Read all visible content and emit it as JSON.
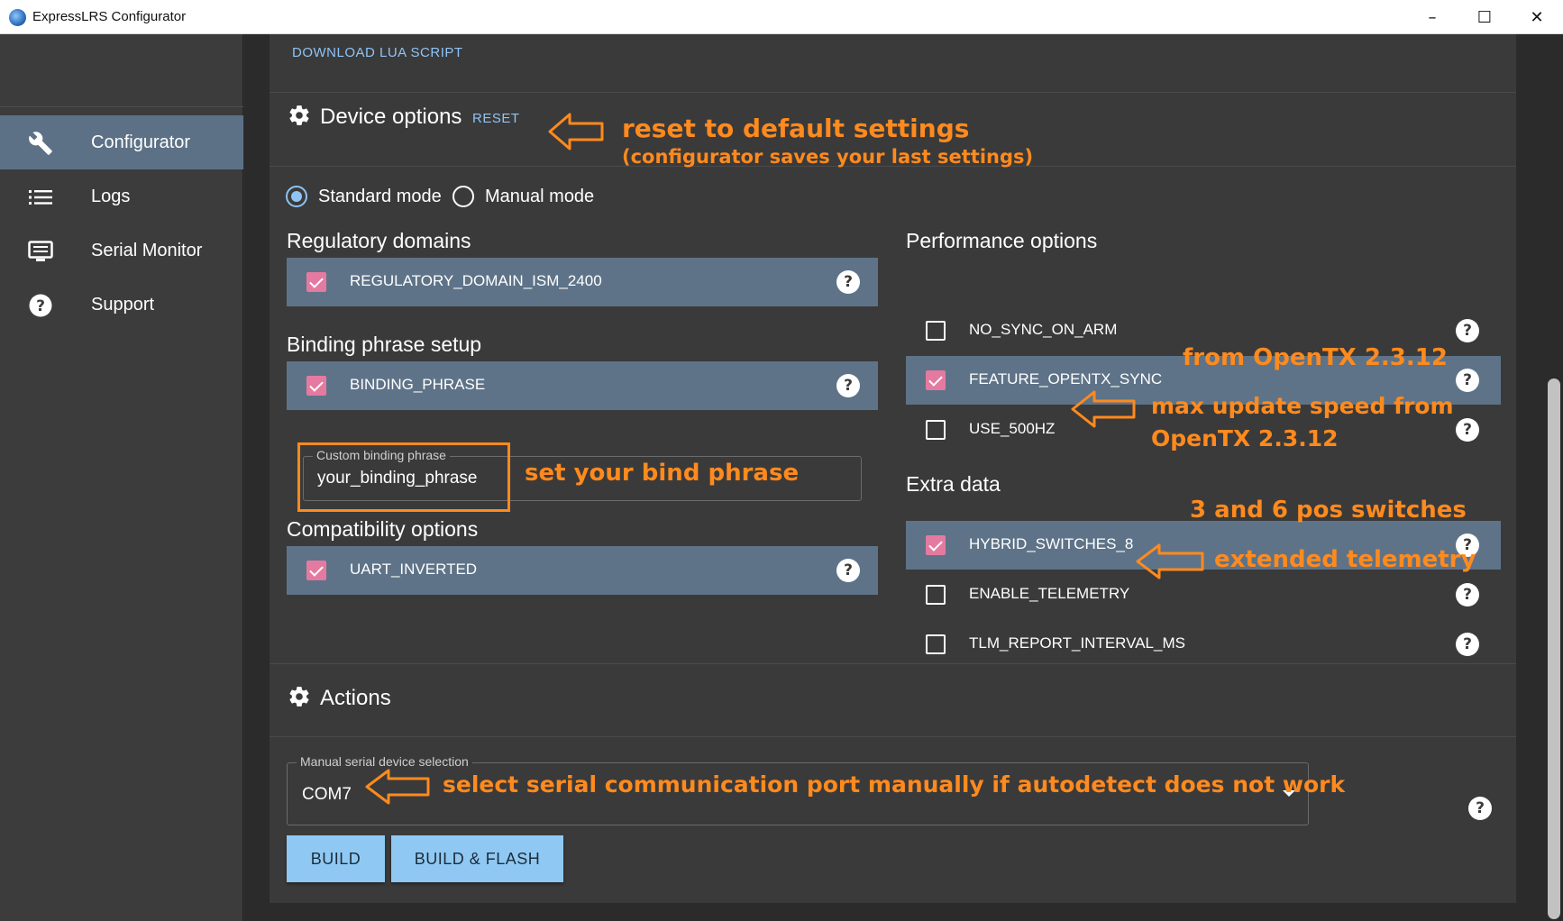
{
  "window": {
    "title": "ExpressLRS Configurator",
    "minimize": "–",
    "maximize": "☐",
    "close": "✕"
  },
  "sidebar": {
    "items": [
      {
        "label": "Configurator",
        "icon": "wrench-icon",
        "active": true
      },
      {
        "label": "Logs",
        "icon": "list-icon",
        "active": false
      },
      {
        "label": "Serial Monitor",
        "icon": "serial-monitor-icon",
        "active": false
      },
      {
        "label": "Support",
        "icon": "help-circle-icon",
        "active": false
      }
    ]
  },
  "main": {
    "download_lua": "DOWNLOAD LUA SCRIPT",
    "device_options": {
      "title": "Device options",
      "reset_label": "RESET",
      "modes": [
        {
          "label": "Standard mode",
          "checked": true
        },
        {
          "label": "Manual mode",
          "checked": false
        }
      ],
      "regulatory": {
        "title": "Regulatory domains",
        "options": [
          {
            "label": "REGULATORY_DOMAIN_ISM_2400",
            "checked": true
          }
        ]
      },
      "binding": {
        "title": "Binding phrase setup",
        "options": [
          {
            "label": "BINDING_PHRASE",
            "checked": true
          }
        ],
        "field_label": "Custom binding phrase",
        "field_value": "your_binding_phrase"
      },
      "compatibility": {
        "title": "Compatibility options",
        "options": [
          {
            "label": "UART_INVERTED",
            "checked": true
          }
        ]
      },
      "performance": {
        "title": "Performance options",
        "options": [
          {
            "label": "NO_SYNC_ON_ARM",
            "checked": false
          },
          {
            "label": "FEATURE_OPENTX_SYNC",
            "checked": true
          },
          {
            "label": "USE_500HZ",
            "checked": false
          }
        ]
      },
      "extra": {
        "title": "Extra data",
        "options": [
          {
            "label": "HYBRID_SWITCHES_8",
            "checked": true
          },
          {
            "label": "ENABLE_TELEMETRY",
            "checked": false
          },
          {
            "label": "TLM_REPORT_INTERVAL_MS",
            "checked": false
          }
        ]
      },
      "help_glyph": "?"
    },
    "actions": {
      "title": "Actions",
      "serial_label": "Manual serial device selection",
      "serial_value": "COM7",
      "build_label": "BUILD",
      "build_flash_label": "BUILD & FLASH"
    }
  },
  "annotations": {
    "reset_line1": "reset to default settings",
    "reset_line2": "(configurator saves your last settings)",
    "bind": "set your bind phrase",
    "opentx_sync": "from OpenTX 2.3.12",
    "use500_line1": "max update speed from",
    "use500_line2": "OpenTX 2.3.12",
    "hybrid": "3 and 6 pos switches",
    "telemetry": "extended telemetry",
    "serial": "select serial communication port manually if autodetect does not work"
  },
  "colors": {
    "accent": "#8fc3f5",
    "checkbox": "#e57aa0",
    "selected_row": "#5e7388",
    "annotation": "#ff8a1e"
  }
}
